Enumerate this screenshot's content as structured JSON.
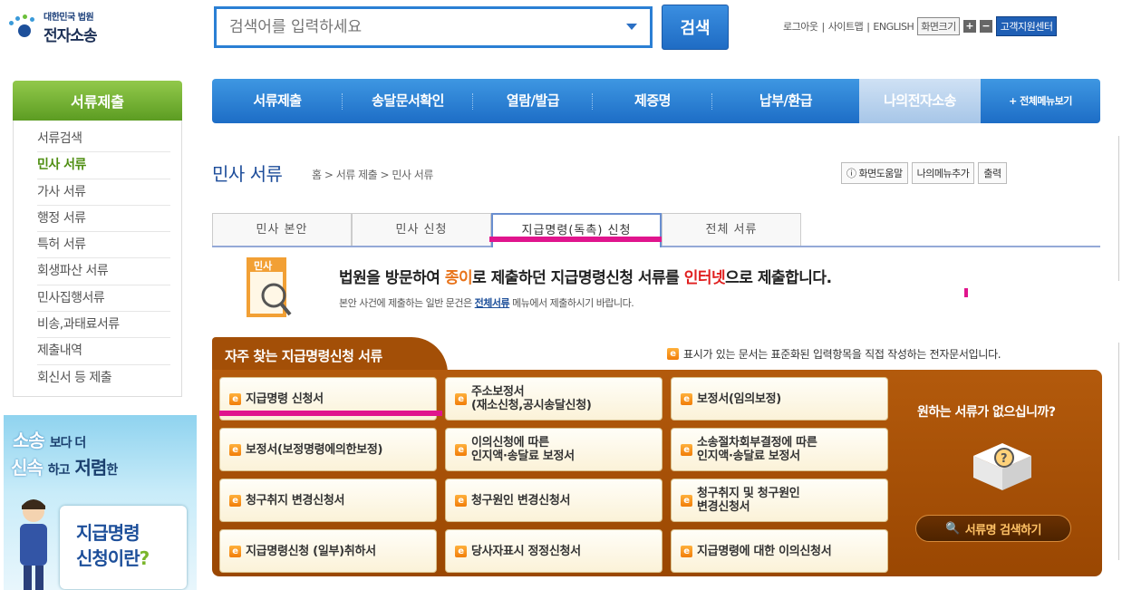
{
  "header": {
    "logo_small": "대한민국 법원",
    "logo_main": "전자소송",
    "search_placeholder": "검색어를 입력하세요",
    "search_button": "검색",
    "util": [
      "로그아웃",
      "사이트맵",
      "ENGLISH"
    ],
    "font_size_label": "화면크기",
    "font_plus": "+",
    "font_minus": "−",
    "help_center": "고객지원센터"
  },
  "sidebar": {
    "title": "서류제출",
    "items": [
      {
        "label": "서류검색"
      },
      {
        "label": "민사 서류",
        "active": true
      },
      {
        "label": "가사 서류"
      },
      {
        "label": "행정 서류"
      },
      {
        "label": "특허 서류"
      },
      {
        "label": "회생파산 서류"
      },
      {
        "label": "민사집행서류"
      },
      {
        "label": "비송,과태료서류"
      },
      {
        "label": "제출내역"
      },
      {
        "label": "회신서 등 제출"
      }
    ],
    "banner": {
      "l1_big": "소송",
      "l1_small": "보다 더",
      "l2_big1": "신속",
      "l2_small1": "하고",
      "l2_big2": "저렴",
      "l2_small2": "한",
      "cal1": "지급명령",
      "cal2": "신청이란",
      "cal2_q": "?"
    }
  },
  "gnb": {
    "items": [
      "서류제출",
      "송달문서확인",
      "열람/발급",
      "제증명",
      "납부/환급",
      "나의전자소송",
      "+ 전체메뉴보기"
    ],
    "current_index": 5
  },
  "page": {
    "title": "민사 서류",
    "breadcrumb": "홈 > 서류 제출 > 민사 서류",
    "tools": [
      "ⓘ 화면도움말",
      "나의메뉴추가",
      "출력"
    ]
  },
  "tabs": [
    {
      "label": "민사 본안"
    },
    {
      "label": "민사 신청"
    },
    {
      "label": "지급명령(독촉) 신청",
      "active": true
    },
    {
      "label": "전체 서류"
    }
  ],
  "info": {
    "icon_label": "민사",
    "line1_a": "법원을 방문하여 ",
    "line1_b": "종이",
    "line1_c": "로 제출하던 지급명령신청 서류를 ",
    "line1_d": "인터넷",
    "line1_e": "으로 제출합니다.",
    "line2_a": "본안 사건에 제출하는 일반 문건은 ",
    "line2_link": "전체서류",
    "line2_b": " 메뉴에서 제출하시기 바랍니다."
  },
  "panel": {
    "title": "자주 찾는 지급명령신청 서류",
    "note": "표시가 있는 문서는 표준화된 입력항목을 직접 작성하는 전자문서입니다.",
    "e_icon": "e",
    "docs": [
      [
        "지급명령 신청서"
      ],
      [
        "주소보정서",
        "(재소신청,공시송달신청)"
      ],
      [
        "보정서(임의보정)"
      ],
      [
        "보정서(보정명령에의한보정)"
      ],
      [
        "이의신청에 따른",
        "인지액·송달료 보정서"
      ],
      [
        "소송절차회부결정에 따른",
        "인지액·송달료 보정서"
      ],
      [
        "청구취지 변경신청서"
      ],
      [
        "청구원인 변경신청서"
      ],
      [
        "청구취지 및 청구원인",
        "변경신청서"
      ],
      [
        "지급명령신청 (일부)취하서"
      ],
      [
        "당사자표시 정정신청서"
      ],
      [
        "지급명령에 대한 이의신청서"
      ]
    ],
    "right_question": "원하는 서류가 없으십니까?",
    "right_button": "서류명 검색하기"
  },
  "colors": {
    "brand_blue": "#1d6dc6",
    "green": "#5c9c22",
    "panel_brown": "#a34f07",
    "highlight_pink": "#e0158d"
  }
}
